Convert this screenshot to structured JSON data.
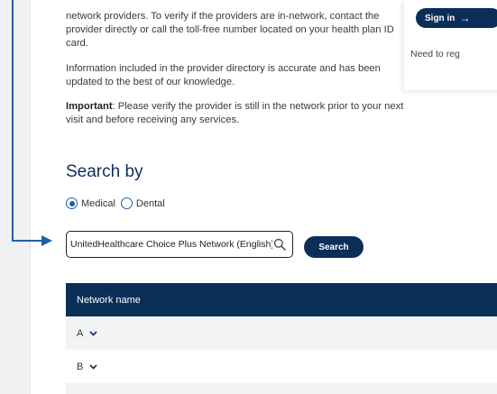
{
  "intro": {
    "paragraph1": "network providers. To verify if the providers are in-network, contact the provider directly or call the toll-free number located on your health plan ID card.",
    "paragraph2": "Information included in the provider directory is accurate and has been updated to the best of our knowledge.",
    "important_label": "Important",
    "important_text": ": Please verify the provider is still in the network prior to your next visit and before receiving any services."
  },
  "side_card": {
    "signin_label": "Sign in",
    "need_register_text": "Need to reg"
  },
  "search": {
    "heading": "Search by",
    "options": [
      {
        "label": "Medical",
        "selected": true
      },
      {
        "label": "Dental",
        "selected": false
      }
    ],
    "input_value": "UnitedHealthcare Choice Plus Network (English)",
    "button_label": "Search"
  },
  "table": {
    "header": "Network name",
    "rows": [
      "A",
      "B"
    ]
  },
  "colors": {
    "brand_navy": "#0b2e59",
    "accent_blue": "#1e5fa8"
  }
}
